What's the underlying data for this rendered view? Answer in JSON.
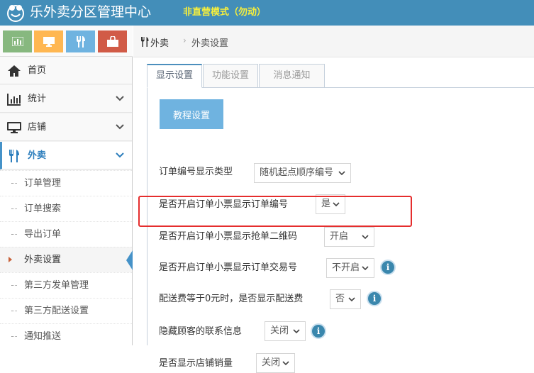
{
  "header": {
    "app_title": "乐外卖分区管理中心",
    "mode_label": "非直营模式（勿动）"
  },
  "shortcuts": [
    {
      "icon": "bar-chart-icon",
      "color": "#87b87f"
    },
    {
      "icon": "monitor-icon",
      "color": "#ffb752"
    },
    {
      "icon": "utensils-icon",
      "color": "#6fb3e0"
    },
    {
      "icon": "shopping-bag-icon",
      "color": "#d15b47"
    }
  ],
  "sidebar": {
    "items": [
      {
        "label": "首页",
        "icon": "home-icon"
      },
      {
        "label": "统计",
        "icon": "bar-chart-icon"
      },
      {
        "label": "店铺",
        "icon": "monitor-icon"
      },
      {
        "label": "外卖",
        "icon": "utensils-icon"
      }
    ],
    "submenu": [
      {
        "label": "订单管理"
      },
      {
        "label": "订单搜索"
      },
      {
        "label": "导出订单"
      },
      {
        "label": "外卖设置"
      },
      {
        "label": "第三方发单管理"
      },
      {
        "label": "第三方配送设置"
      },
      {
        "label": "通知推送"
      }
    ]
  },
  "breadcrumb": {
    "root": "外卖",
    "separator": "›",
    "current": "外卖设置"
  },
  "tabs": [
    {
      "label": "显示设置"
    },
    {
      "label": "功能设置"
    },
    {
      "label": "消息通知"
    }
  ],
  "tutorial_button": "教程设置",
  "settings": [
    {
      "label": "订单编号显示类型",
      "value": "随机起点顺序编号"
    },
    {
      "label": "是否开启订单小票显示订单编号",
      "value": "是"
    },
    {
      "label": "是否开启订单小票显示抢单二维码",
      "value": "开启"
    },
    {
      "label": "是否开启订单小票显示订单交易号",
      "value": "不开启"
    },
    {
      "label": "配送费等于0元时，是否显示配送费",
      "value": "否"
    },
    {
      "label": "隐藏顾客的联系信息",
      "value": "关闭"
    },
    {
      "label": "是否显示店铺销量",
      "value": "关闭"
    }
  ],
  "info_glyph": "i",
  "colors": {
    "header_bg": "#438eb9",
    "mode_label": "#f7ef3c",
    "accent": "#4592c8",
    "highlight": "#e52d2d",
    "button": "#6fb3e0"
  }
}
